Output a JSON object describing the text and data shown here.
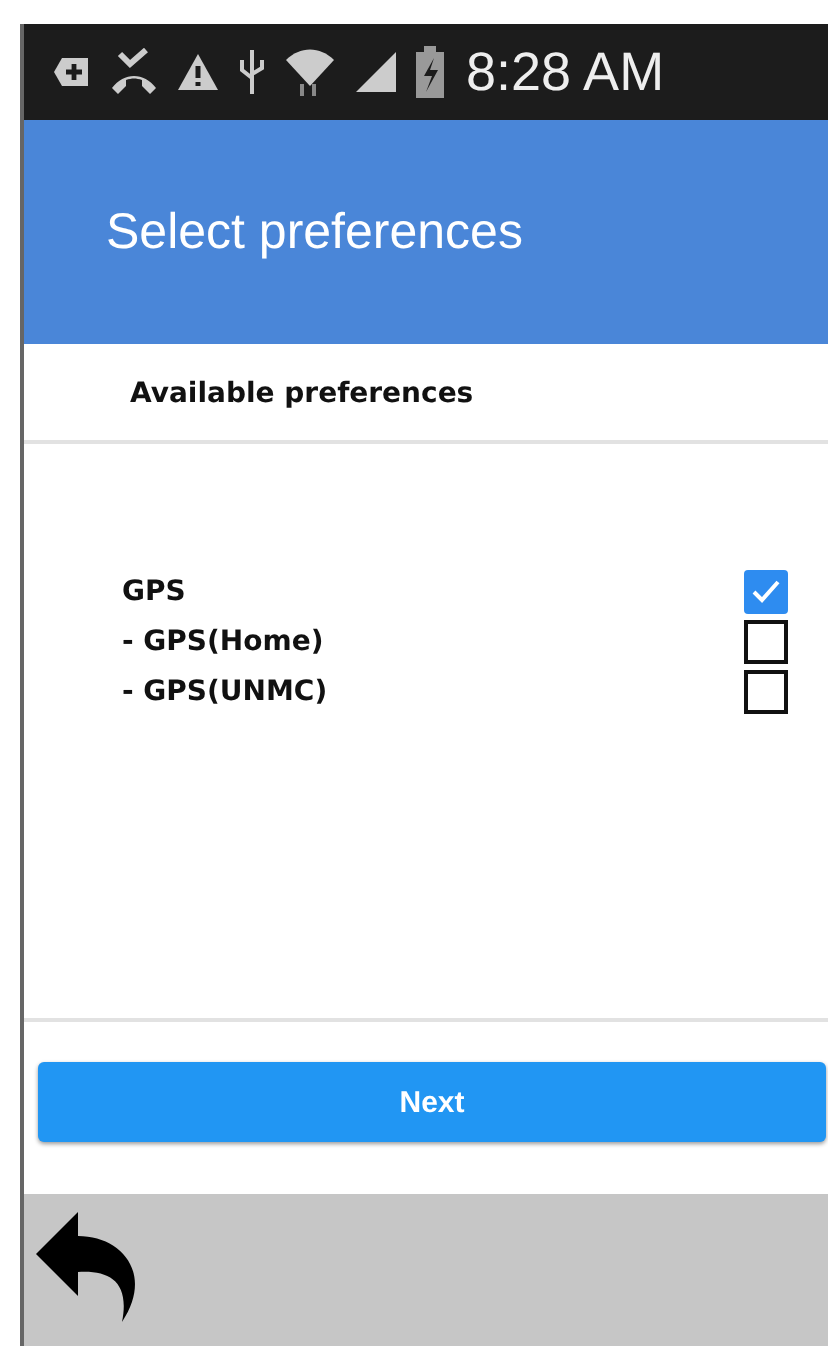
{
  "status_bar": {
    "time": "8:28 AM"
  },
  "header": {
    "title": "Select preferences"
  },
  "section": {
    "title": "Available preferences"
  },
  "preferences": [
    {
      "label": "GPS",
      "checked": true
    },
    {
      "label": "- GPS(Home)",
      "checked": false
    },
    {
      "label": "- GPS(UNMC)",
      "checked": false
    }
  ],
  "next_button": {
    "label": "Next"
  }
}
